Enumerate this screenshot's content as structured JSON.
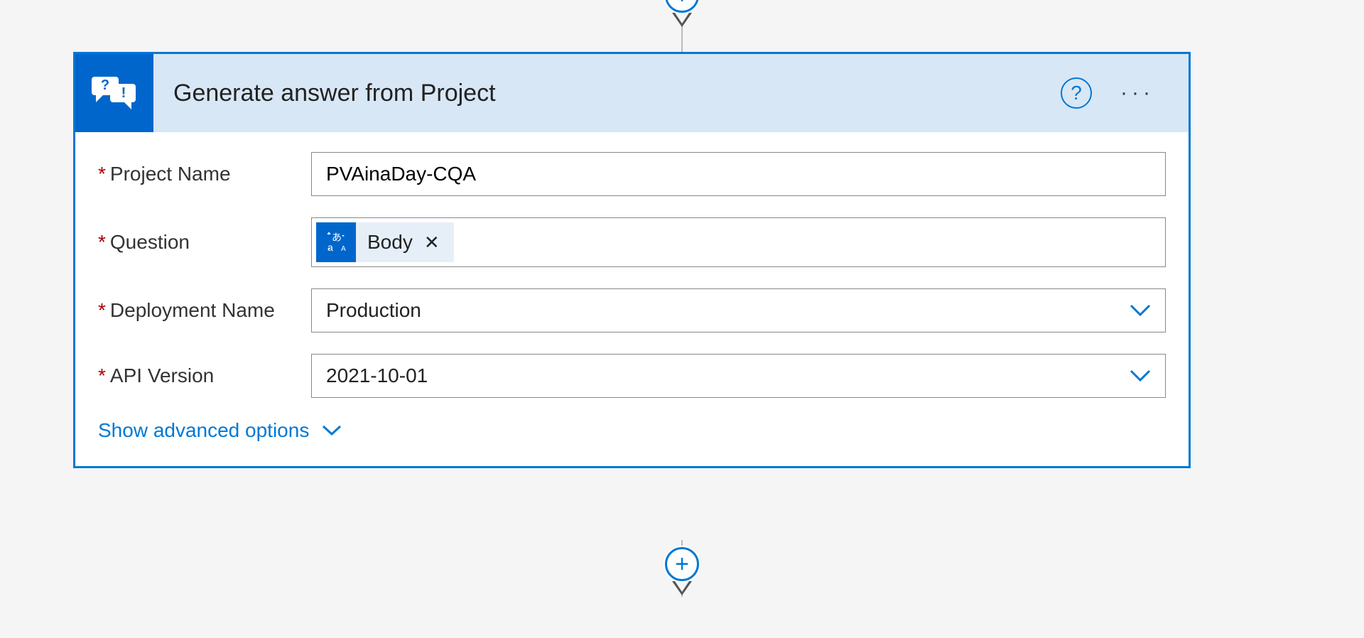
{
  "card": {
    "title": "Generate answer from Project",
    "icon_name": "qna-chat-icon",
    "help_label": "?",
    "more_label": "···"
  },
  "fields": {
    "project_name": {
      "label": "Project Name",
      "value": "PVAinaDay-CQA",
      "required": true
    },
    "question": {
      "label": "Question",
      "token_label": "Body",
      "token_icon_name": "translate-icon",
      "required": true
    },
    "deployment_name": {
      "label": "Deployment Name",
      "value": "Production",
      "required": true
    },
    "api_version": {
      "label": "API Version",
      "value": "2021-10-01",
      "required": true
    }
  },
  "advanced_link": "Show advanced options",
  "add_button_label": "+"
}
